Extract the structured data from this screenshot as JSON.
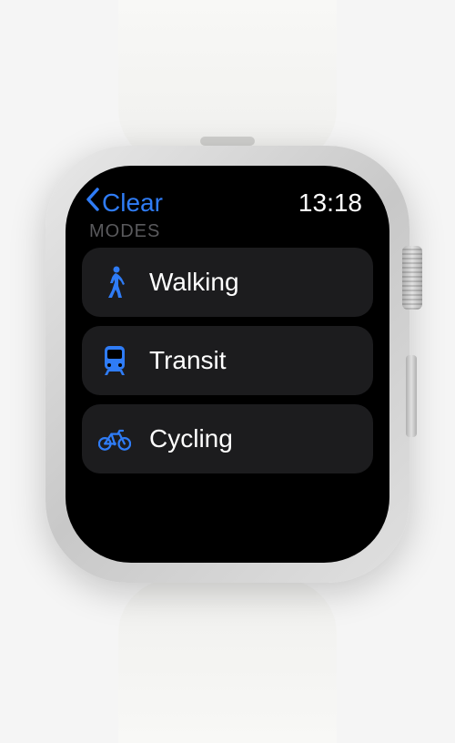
{
  "header": {
    "back_label": "Clear",
    "time": "13:18"
  },
  "section": {
    "title": "MODES"
  },
  "modes": [
    {
      "icon": "walking-icon",
      "label": "Walking"
    },
    {
      "icon": "transit-icon",
      "label": "Transit"
    },
    {
      "icon": "cycling-icon",
      "label": "Cycling"
    }
  ],
  "colors": {
    "accent": "#2f7cf6",
    "cell_bg": "#1c1c1e"
  }
}
